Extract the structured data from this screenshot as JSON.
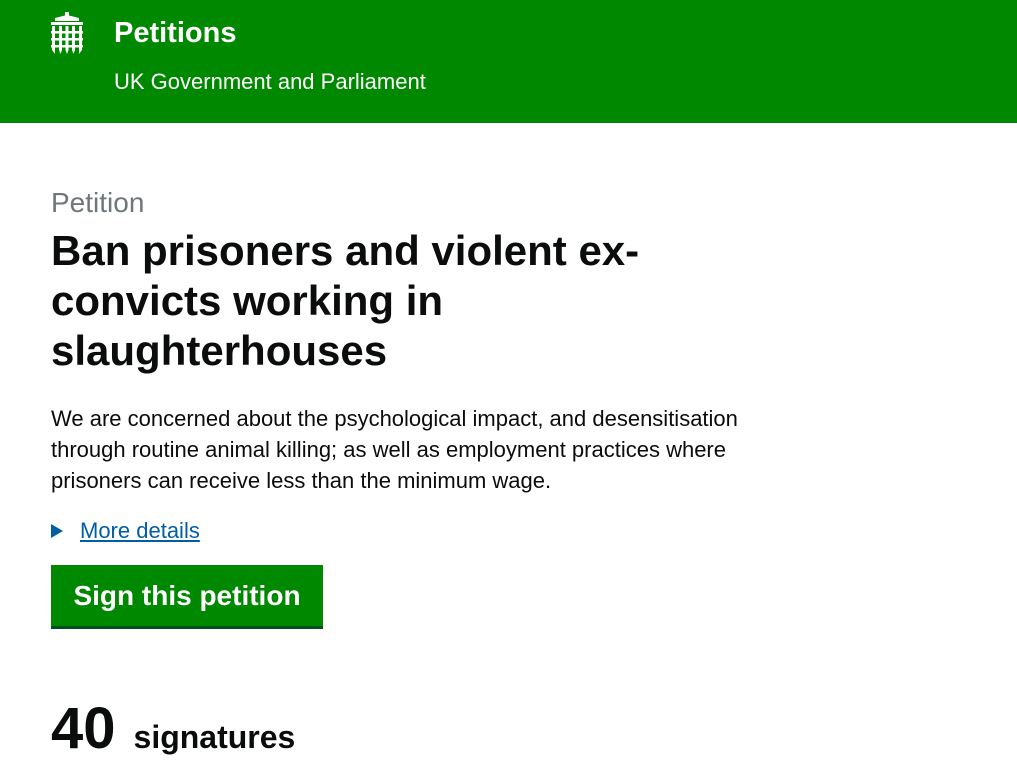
{
  "header": {
    "logo_icon": "portcullis-icon",
    "title": "Petitions",
    "subtitle": "UK Government and Parliament",
    "background_color": "#008800"
  },
  "petition": {
    "caption": "Petition",
    "title": "Ban prisoners and violent ex-convicts working in slaughterhouses",
    "summary": "We are concerned about the psychological impact, and desensitisation through routine animal killing; as well as employment practices where prisoners can receive less than the minimum wage.",
    "more_details_label": "More details",
    "more_details_icon": "triangle-right-icon",
    "sign_button_label": "Sign this petition",
    "signature_count": "40",
    "signature_label": "signatures"
  },
  "colors": {
    "link": "#005ea5",
    "button": "#008800",
    "caption": "#6f777b",
    "text": "#0b0c0c"
  }
}
